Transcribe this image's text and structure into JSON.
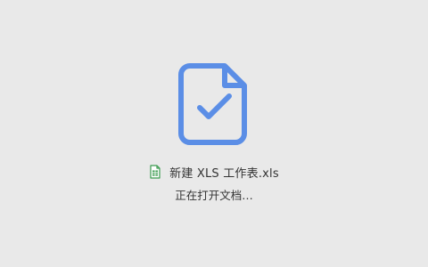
{
  "app": {
    "background_color": "#e9e9e9",
    "accent_color": "#5b8ee6"
  },
  "loader": {
    "main_icon": "document-check-icon",
    "file_icon": "spreadsheet-file-icon",
    "file_name": "新建 XLS 工作表.xls",
    "status": "正在打开文档…"
  }
}
